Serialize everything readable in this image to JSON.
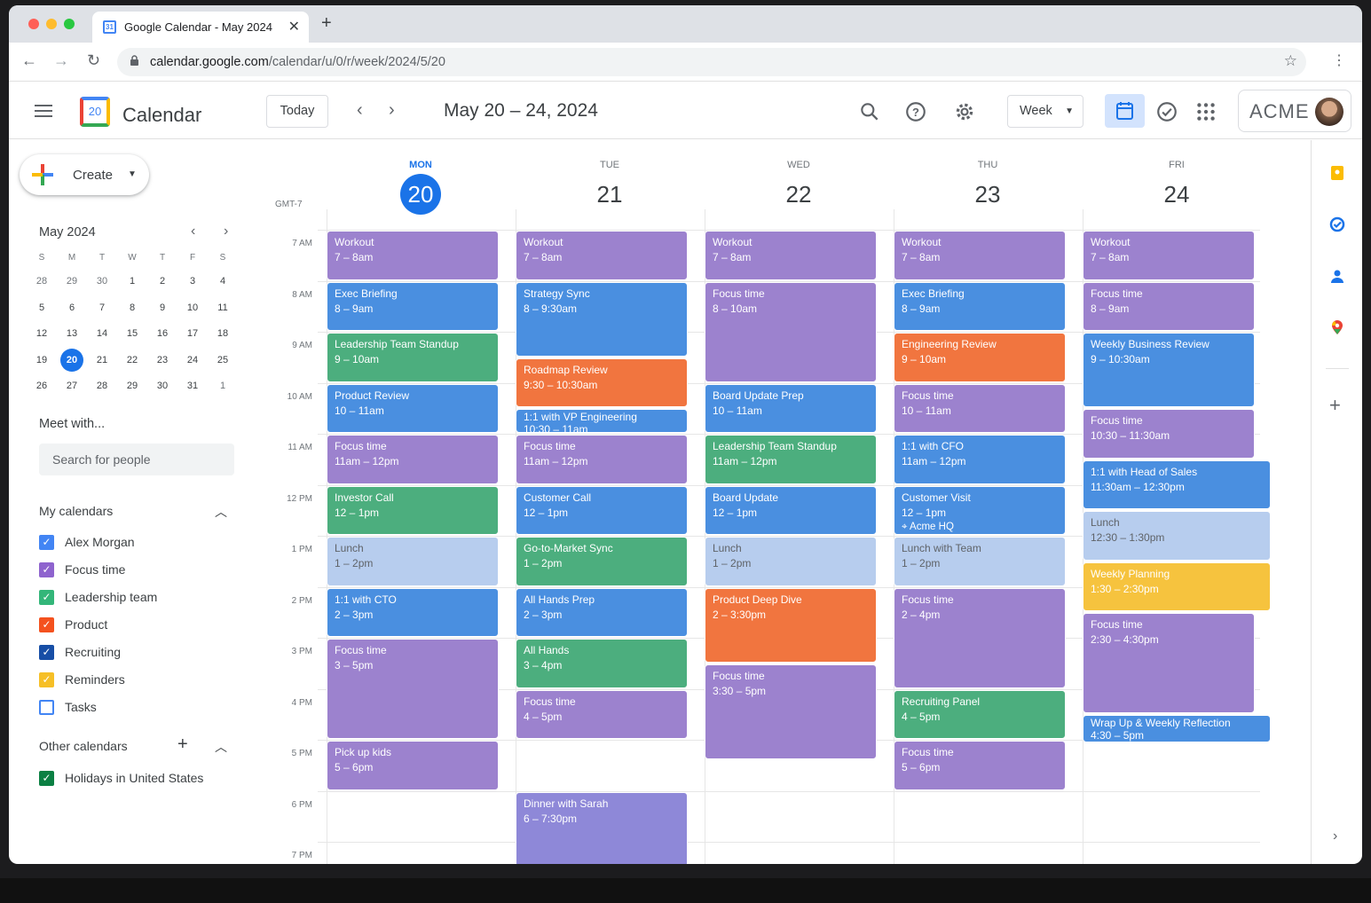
{
  "browser": {
    "tab_title": "Google Calendar - May 2024",
    "url_host": "calendar.google.com",
    "url_path": "/calendar/u/0/r/week/2024/5/20"
  },
  "header": {
    "app_name": "Calendar",
    "logo_day": "20",
    "today_label": "Today",
    "date_range": "May 20 – 24, 2024",
    "view_label": "Week",
    "org_name": "ACME"
  },
  "sidebar": {
    "create_label": "Create",
    "mini_month": "May 2024",
    "weekday_initials": [
      "S",
      "M",
      "T",
      "W",
      "T",
      "F",
      "S"
    ],
    "weeks": [
      [
        "28",
        "29",
        "30",
        "1",
        "2",
        "3",
        "4"
      ],
      [
        "5",
        "6",
        "7",
        "8",
        "9",
        "10",
        "11"
      ],
      [
        "12",
        "13",
        "14",
        "15",
        "16",
        "17",
        "18"
      ],
      [
        "19",
        "20",
        "21",
        "22",
        "23",
        "24",
        "25"
      ],
      [
        "26",
        "27",
        "28",
        "29",
        "30",
        "31",
        "1"
      ]
    ],
    "selected_date": "20",
    "meet_with": "Meet with...",
    "search_placeholder": "Search for people",
    "my_calendars_title": "My calendars",
    "my_calendars": [
      {
        "label": "Alex Morgan",
        "color": "#4285f4",
        "checked": true
      },
      {
        "label": "Focus time",
        "color": "#8e63ce",
        "checked": true
      },
      {
        "label": "Leadership team",
        "color": "#33b679",
        "checked": true
      },
      {
        "label": "Product",
        "color": "#f4511e",
        "checked": true
      },
      {
        "label": "Recruiting",
        "color": "#174ea6",
        "checked": true
      },
      {
        "label": "Reminders",
        "color": "#f6bf26",
        "checked": true
      },
      {
        "label": "Tasks",
        "color": "#4285f4",
        "checked": false
      }
    ],
    "other_calendars_title": "Other calendars",
    "other_calendars": [
      {
        "label": "Holidays in United States",
        "color": "#0b8043",
        "checked": true
      }
    ]
  },
  "grid": {
    "timezone": "GMT-7",
    "hours": [
      "7 AM",
      "8 AM",
      "9 AM",
      "10 AM",
      "11 AM",
      "12 PM",
      "1 PM",
      "2 PM",
      "3 PM",
      "4 PM",
      "5 PM",
      "6 PM",
      "7 PM"
    ],
    "days": [
      {
        "dow": "MON",
        "num": "20",
        "today": true
      },
      {
        "dow": "TUE",
        "num": "21",
        "today": false
      },
      {
        "dow": "WED",
        "num": "22",
        "today": false
      },
      {
        "dow": "THU",
        "num": "23",
        "today": false
      },
      {
        "dow": "FRI",
        "num": "24",
        "today": false
      }
    ]
  },
  "events": [
    {
      "day": 0,
      "start": 7,
      "end": 8,
      "title": "Workout",
      "time": "7 – 8am",
      "kind": "focus"
    },
    {
      "day": 0,
      "start": 8,
      "end": 9,
      "title": "Exec Briefing",
      "time": "8 – 9am",
      "kind": "blue"
    },
    {
      "day": 0,
      "start": 9,
      "end": 10,
      "title": "Leadership Team Standup",
      "time": "9 – 10am",
      "kind": "green"
    },
    {
      "day": 0,
      "start": 10,
      "end": 11,
      "title": "Product Review",
      "time": "10 – 11am",
      "kind": "blue"
    },
    {
      "day": 0,
      "start": 11,
      "end": 12,
      "title": "Focus time",
      "time": "11am – 12pm",
      "kind": "focus"
    },
    {
      "day": 0,
      "start": 12,
      "end": 13,
      "title": "Investor Call",
      "time": "12 – 1pm",
      "kind": "green"
    },
    {
      "day": 0,
      "start": 13,
      "end": 14,
      "title": "Lunch",
      "time": "1 – 2pm",
      "kind": "lunch"
    },
    {
      "day": 0,
      "start": 14,
      "end": 15,
      "title": "1:1 with CTO",
      "time": "2 – 3pm",
      "kind": "blue"
    },
    {
      "day": 0,
      "start": 15,
      "end": 17,
      "title": "Focus time",
      "time": "3 – 5pm",
      "kind": "focus"
    },
    {
      "day": 0,
      "start": 17,
      "end": 18,
      "title": "Pick up kids",
      "time": "5 – 6pm",
      "kind": "focus"
    },
    {
      "day": 1,
      "start": 7,
      "end": 8,
      "title": "Workout",
      "time": "7 – 8am",
      "kind": "focus"
    },
    {
      "day": 1,
      "start": 8,
      "end": 9.5,
      "title": "Strategy Sync",
      "time": "8 – 9:30am",
      "kind": "blue"
    },
    {
      "day": 1,
      "start": 9.5,
      "end": 10.5,
      "title": "Roadmap Review",
      "time": "9:30 – 10:30am",
      "kind": "orange"
    },
    {
      "day": 1,
      "start": 10.5,
      "end": 11,
      "title": "1:1 with VP Engineering",
      "time": "10:30 – 11am",
      "kind": "blue"
    },
    {
      "day": 1,
      "start": 11,
      "end": 12,
      "title": "Focus time",
      "time": "11am – 12pm",
      "kind": "focus"
    },
    {
      "day": 1,
      "start": 12,
      "end": 13,
      "title": "Customer Call",
      "time": "12 – 1pm",
      "kind": "blue"
    },
    {
      "day": 1,
      "start": 13,
      "end": 14,
      "title": "Go-to-Market Sync",
      "time": "1 – 2pm",
      "kind": "green"
    },
    {
      "day": 1,
      "start": 14,
      "end": 15,
      "title": "All Hands Prep",
      "time": "2 – 3pm",
      "kind": "blue"
    },
    {
      "day": 1,
      "start": 15,
      "end": 16,
      "title": "All Hands",
      "time": "3 – 4pm",
      "kind": "green"
    },
    {
      "day": 1,
      "start": 16,
      "end": 17,
      "title": "Focus time",
      "time": "4 – 5pm",
      "kind": "focus"
    },
    {
      "day": 1,
      "start": 18,
      "end": 19.5,
      "title": "Dinner with Sarah",
      "time": "6 – 7:30pm",
      "kind": "personal"
    },
    {
      "day": 2,
      "start": 7,
      "end": 8,
      "title": "Workout",
      "time": "7 – 8am",
      "kind": "focus"
    },
    {
      "day": 2,
      "start": 8,
      "end": 10,
      "title": "Focus time",
      "time": "8 – 10am",
      "kind": "focus"
    },
    {
      "day": 2,
      "start": 10,
      "end": 11,
      "title": "Board Update Prep",
      "time": "10 – 11am",
      "kind": "blue"
    },
    {
      "day": 2,
      "start": 11,
      "end": 12,
      "title": "Leadership Team Standup",
      "time": "11am – 12pm",
      "kind": "green"
    },
    {
      "day": 2,
      "start": 12,
      "end": 13,
      "title": "Board Update",
      "time": "12 – 1pm",
      "kind": "blue"
    },
    {
      "day": 2,
      "start": 13,
      "end": 14,
      "title": "Lunch",
      "time": "1 – 2pm",
      "kind": "lunch"
    },
    {
      "day": 2,
      "start": 14,
      "end": 15.5,
      "title": "Product Deep Dive",
      "time": "2 – 3:30pm",
      "kind": "orange"
    },
    {
      "day": 2,
      "start": 15.5,
      "end": 17.4,
      "title": "Focus time",
      "time": "3:30 – 5pm",
      "kind": "focus"
    },
    {
      "day": 3,
      "start": 7,
      "end": 8,
      "title": "Workout",
      "time": "7 – 8am",
      "kind": "focus"
    },
    {
      "day": 3,
      "start": 8,
      "end": 9,
      "title": "Exec Briefing",
      "time": "8 – 9am",
      "kind": "blue"
    },
    {
      "day": 3,
      "start": 9,
      "end": 10,
      "title": "Engineering Review",
      "time": "9 – 10am",
      "kind": "orange"
    },
    {
      "day": 3,
      "start": 10,
      "end": 11,
      "title": "Focus time",
      "time": "10 – 11am",
      "kind": "focus"
    },
    {
      "day": 3,
      "start": 11,
      "end": 12,
      "title": "1:1 with CFO",
      "time": "11am – 12pm",
      "kind": "blue"
    },
    {
      "day": 3,
      "start": 12,
      "end": 13,
      "title": "Customer Visit",
      "time": "12 – 1pm",
      "location": "Acme HQ",
      "kind": "blue"
    },
    {
      "day": 3,
      "start": 13,
      "end": 14,
      "title": "Lunch with Team",
      "time": "1 – 2pm",
      "kind": "lunch"
    },
    {
      "day": 3,
      "start": 14,
      "end": 16,
      "title": "Focus time",
      "time": "2 – 4pm",
      "kind": "focus"
    },
    {
      "day": 3,
      "start": 16,
      "end": 17,
      "title": "Recruiting Panel",
      "time": "4 – 5pm",
      "kind": "green"
    },
    {
      "day": 3,
      "start": 17,
      "end": 18,
      "title": "Focus time",
      "time": "5 – 6pm",
      "kind": "focus"
    },
    {
      "day": 4,
      "start": 7,
      "end": 8,
      "title": "Workout",
      "time": "7 – 8am",
      "kind": "focus"
    },
    {
      "day": 4,
      "start": 8,
      "end": 9,
      "title": "Focus time",
      "time": "8 – 9am",
      "kind": "focus"
    },
    {
      "day": 4,
      "start": 9,
      "end": 10.5,
      "title": "Weekly Business Review",
      "time": "9 – 10:30am",
      "kind": "blue"
    },
    {
      "day": 4,
      "start": 10.5,
      "end": 11.5,
      "title": "Focus time",
      "time": "10:30 – 11:30am",
      "kind": "focus"
    },
    {
      "day": 4,
      "start": 11.5,
      "end": 12.5,
      "title": "1:1 with Head of Sales",
      "time": "11:30am – 12:30pm",
      "kind": "blue"
    },
    {
      "day": 4,
      "start": 12.5,
      "end": 13.5,
      "title": "Lunch",
      "time": "12:30 – 1:30pm",
      "kind": "lunch"
    },
    {
      "day": 4,
      "start": 13.5,
      "end": 14.5,
      "title": "Weekly Planning",
      "time": "1:30 – 2:30pm",
      "kind": "yellow"
    },
    {
      "day": 4,
      "start": 14.5,
      "end": 16.5,
      "title": "Focus time",
      "time": "2:30 – 4:30pm",
      "kind": "focus"
    },
    {
      "day": 4,
      "start": 16.5,
      "end": 17.07,
      "title": "Wrap Up & Weekly Reflection",
      "time": "4:30 – 5pm",
      "kind": "blue"
    }
  ]
}
